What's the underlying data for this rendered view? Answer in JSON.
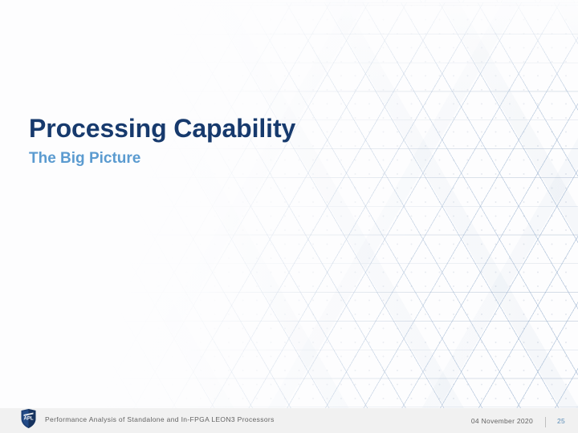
{
  "slide": {
    "title": "Processing Capability",
    "subtitle": "The Big Picture",
    "background_style": "triangle-lattice",
    "colors": {
      "title": "#173a6d",
      "subtitle": "#5b9bd0",
      "footer_text": "#636363",
      "page_number": "#5b8db8",
      "footer_bar": "#f1f1f1",
      "canvas": "#fdfdfe",
      "lattice_line": "#82a0c3"
    }
  },
  "footer": {
    "logo_name": "apl-shield-logo",
    "logo_text": "APL",
    "text": "Performance Analysis of Standalone and In-FPGA LEON3 Processors",
    "date": "04 November 2020",
    "divider": "|",
    "page_number": "25"
  }
}
